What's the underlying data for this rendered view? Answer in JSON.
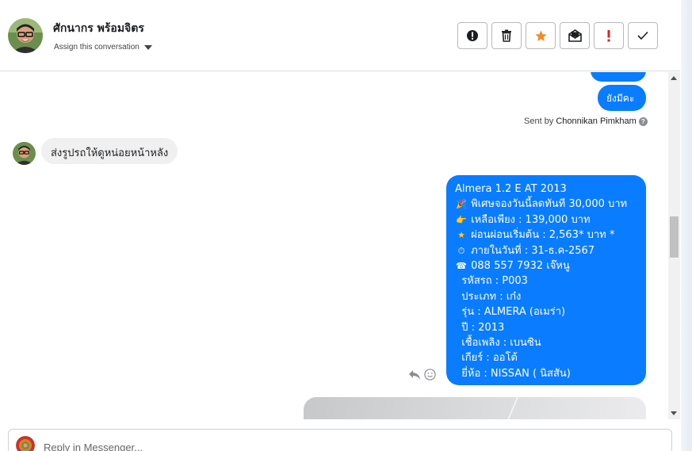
{
  "header": {
    "contact_name": "ศักนากร พร้อมจิตร",
    "assign_label": "Assign this conversation",
    "actions": [
      {
        "name": "mark-spam-button",
        "icon": "alert-circle-icon"
      },
      {
        "name": "delete-button",
        "icon": "trash-icon"
      },
      {
        "name": "star-button",
        "icon": "star-icon",
        "color": "#f28b24"
      },
      {
        "name": "mark-unread-button",
        "icon": "envelope-icon"
      },
      {
        "name": "follow-up-button",
        "icon": "exclamation-icon",
        "color": "#e02020"
      },
      {
        "name": "mark-done-button",
        "icon": "check-icon"
      }
    ]
  },
  "messages": {
    "outgoing_short": "ยังมีคะ",
    "sent_by_prefix": "Sent by",
    "sent_by_name": "Chonnikan Pimkham",
    "incoming_text": "ส่งรูปรถให้ดูหน่อยหน้าหลัง",
    "car_listing": {
      "l1": "Almera 1.2 E AT 2013",
      "l2": "พิเศษจองวันนี้ลดทันที 30,000 บาท",
      "l3": "เหลือเพียง : 139,000 บาท",
      "l4": "ผ่อนผ่อนเริ่มต้น : 2,563* บาท *",
      "l5": "ภายในวันที่ : 31-ธ.ค-2567",
      "l6": "088 557 7932 เจ๊หนู",
      "l7": "รหัสรถ : P003",
      "l8": "ประเภท : เก๋ง",
      "l9": "รุ่น : ALMERA (อเมร่า)",
      "l10": "ปี : 2013",
      "l11": "เชื้อเพลิง : เบนซิน",
      "l12": "เกียร์ : ออโต้",
      "l13": "ยี่ห้อ : NISSAN ( นิสสัน)"
    },
    "listing_icons": [
      "party-popper-icon",
      "pointing-hand-icon",
      "star-icon",
      "stopwatch-icon",
      "telephone-icon"
    ]
  },
  "composer": {
    "placeholder": "Reply in Messenger..."
  },
  "colors": {
    "outgoing_bubble": "#0a7cff",
    "incoming_bubble": "#f0f0f0"
  }
}
